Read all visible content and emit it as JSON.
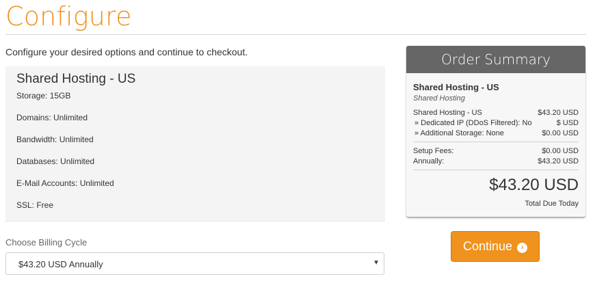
{
  "page": {
    "title": "Configure",
    "intro": "Configure your desired options and continue to checkout."
  },
  "product": {
    "name": "Shared Hosting - US",
    "features": [
      "Storage: 15GB",
      "Domains: Unlimited",
      "Bandwidth: Unlimited",
      "Databases: Unlimited",
      "E-Mail Accounts: Unlimited",
      "SSL: Free"
    ]
  },
  "billing": {
    "label": "Choose Billing Cycle",
    "selected": "$43.20 USD Annually"
  },
  "summary": {
    "heading": "Order Summary",
    "product": "Shared Hosting - US",
    "group": "Shared Hosting",
    "lines": [
      {
        "label": "Shared Hosting - US",
        "value": "$43.20 USD"
      },
      {
        "label": "» Dedicated IP (DDoS Filtered): No",
        "value": "$ USD"
      },
      {
        "label": "» Additional Storage: None",
        "value": "$0.00 USD"
      }
    ],
    "fees": [
      {
        "label": "Setup Fees:",
        "value": "$0.00 USD"
      },
      {
        "label": "Annually:",
        "value": "$43.20 USD"
      }
    ],
    "total": "$43.20 USD",
    "total_label": "Total Due Today"
  },
  "actions": {
    "continue": "Continue"
  },
  "colors": {
    "accent": "#f0921e",
    "summary_header": "#666666"
  }
}
